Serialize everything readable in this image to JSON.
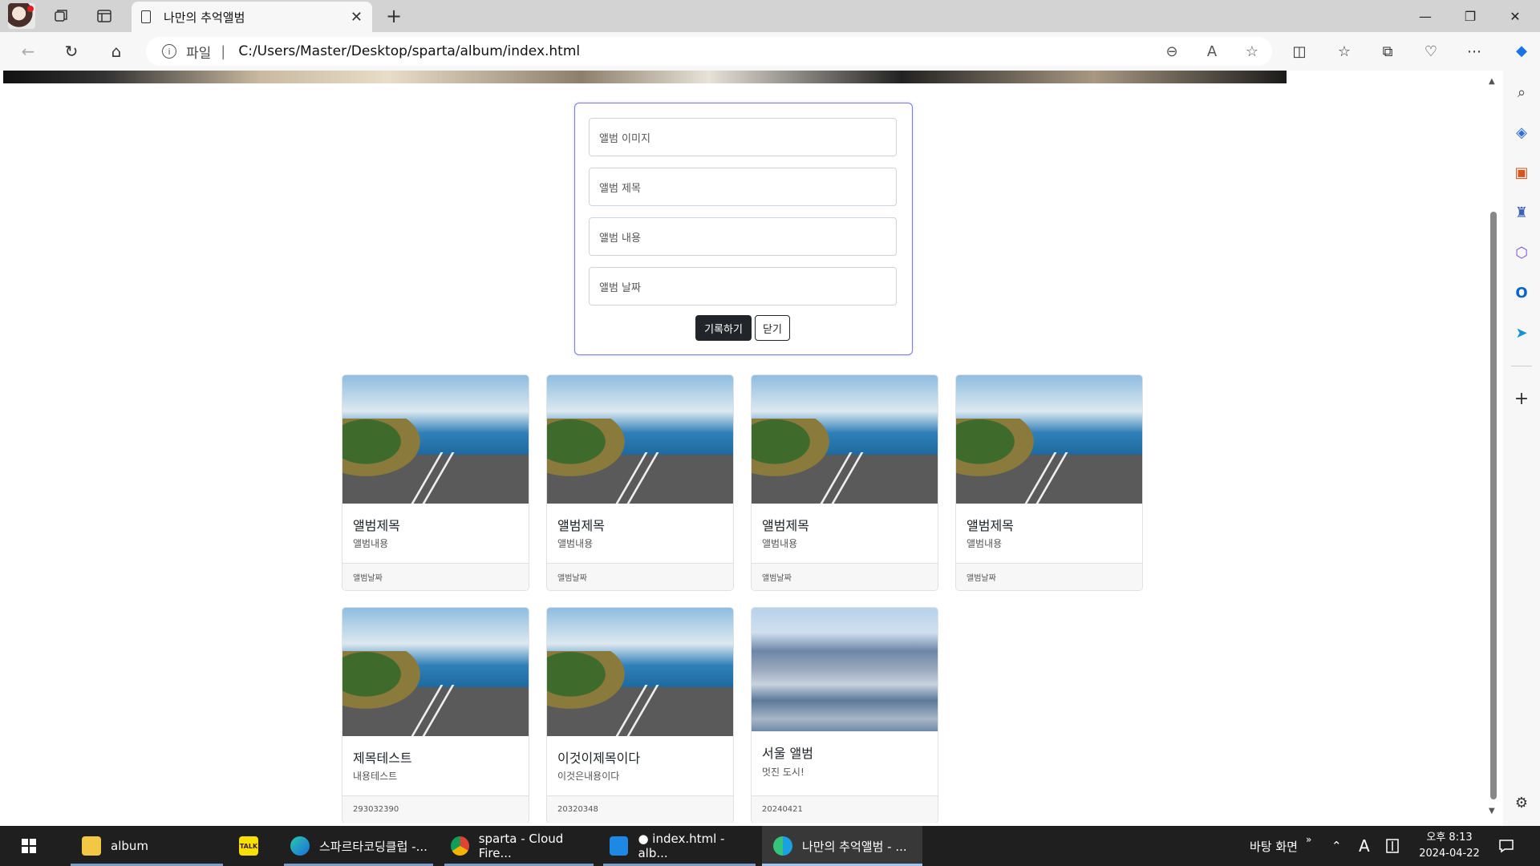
{
  "browser": {
    "tab_title": "나만의 추억앨범",
    "tab_close": "✕",
    "new_tab": "+",
    "scheme_label": "파일",
    "url": "C:/Users/Master/Desktop/sparta/album/index.html"
  },
  "form": {
    "image_placeholder": "앨범 이미지",
    "title_placeholder": "앨범 제목",
    "content_placeholder": "앨범 내용",
    "date_placeholder": "앨범 날짜",
    "save_label": "기록하기",
    "close_label": "닫기"
  },
  "cards": [
    {
      "title": "앨범제목",
      "text": "앨범내용",
      "date": "앨범날짜",
      "image": "road"
    },
    {
      "title": "앨범제목",
      "text": "앨범내용",
      "date": "앨범날짜",
      "image": "road"
    },
    {
      "title": "앨범제목",
      "text": "앨범내용",
      "date": "앨범날짜",
      "image": "road"
    },
    {
      "title": "앨범제목",
      "text": "앨범내용",
      "date": "앨범날짜",
      "image": "road"
    },
    {
      "title": "제목테스트",
      "text": "내용테스트",
      "date": "293032390",
      "image": "road"
    },
    {
      "title": "이것이제목이다",
      "text": "이것은내용이다",
      "date": "20320348",
      "image": "road"
    },
    {
      "title": "서울 앨범",
      "text": "멋진 도시!",
      "date": "20240421",
      "image": "city"
    }
  ],
  "taskbar": {
    "items": [
      {
        "label": "album"
      },
      {
        "label": ""
      },
      {
        "label": "스파르타코딩클럽 -..."
      },
      {
        "label": "sparta - Cloud Fire..."
      },
      {
        "label": "● index.html - alb..."
      },
      {
        "label": "나만의 추억앨범 - ..."
      }
    ],
    "desktop_label": "바탕 화면",
    "ime_label": "A",
    "time": "오후 8:13",
    "date": "2024-04-22"
  },
  "colors": {
    "accent": "#7b7bf0",
    "button_dark": "#212529",
    "taskbar_bg": "#1f1f1f"
  }
}
